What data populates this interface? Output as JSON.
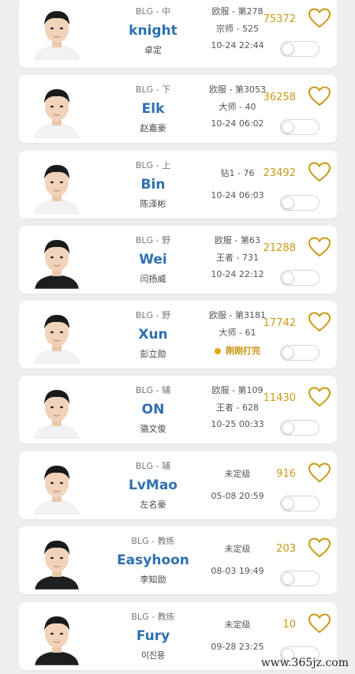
{
  "players": [
    {
      "team_pos": "BLG - 中",
      "name": "knight",
      "real": "卓定",
      "server": "欧服 - 第278",
      "tier": "宗师 - 525",
      "time": "10-24 22:44",
      "status": "",
      "likes": "75372",
      "icon": "heart-outline-icon",
      "shirt": "#f2f2f2"
    },
    {
      "team_pos": "BLG - 下",
      "name": "Elk",
      "real": "赵嘉豪",
      "server": "欧服 - 第3053",
      "tier": "大师 - 40",
      "time": "10-24 06:02",
      "status": "",
      "likes": "36258",
      "icon": "heart-outline-icon",
      "shirt": "#f2f2f2"
    },
    {
      "team_pos": "BLG - 上",
      "name": "Bin",
      "real": "陈泽彬",
      "server": "",
      "tier": "钻1 - 76",
      "time": "10-24 06:03",
      "status": "",
      "likes": "23492",
      "icon": "heart-outline-icon",
      "shirt": "#f2f2f2"
    },
    {
      "team_pos": "BLG - 野",
      "name": "Wei",
      "real": "闫扬威",
      "server": "欧服 - 第63",
      "tier": "王者 - 731",
      "time": "10-24 22:12",
      "status": "",
      "likes": "21288",
      "icon": "heart-outline-icon",
      "shirt": "#1e1e1e"
    },
    {
      "team_pos": "BLG - 野",
      "name": "Xun",
      "real": "彭立勋",
      "server": "欧服 - 第3181",
      "tier": "大师 - 61",
      "time": "",
      "status": "刚刚打完",
      "likes": "17742",
      "icon": "heart-outline-icon",
      "shirt": "#f2f2f2"
    },
    {
      "team_pos": "BLG - 辅",
      "name": "ON",
      "real": "骆文俊",
      "server": "欧服 - 第109",
      "tier": "王者 - 628",
      "time": "10-25 00:33",
      "status": "",
      "likes": "11430",
      "icon": "heart-outline-icon",
      "shirt": "#f2f2f2"
    },
    {
      "team_pos": "BLG - 辅",
      "name": "LvMao",
      "real": "左名豪",
      "server": "",
      "tier": "未定级",
      "time": "05-08 20:59",
      "status": "",
      "likes": "916",
      "icon": "heart-outline-icon",
      "shirt": "#f2f2f2"
    },
    {
      "team_pos": "BLG - 教练",
      "name": "Easyhoon",
      "real": "李知勋",
      "server": "",
      "tier": "未定级",
      "time": "08-03 19:49",
      "status": "",
      "likes": "203",
      "icon": "heart-outline-icon",
      "shirt": "#1e1e1e"
    },
    {
      "team_pos": "BLG - 教练",
      "name": "Fury",
      "real": "이진용",
      "server": "",
      "tier": "未定级",
      "time": "09-28 23:25",
      "status": "",
      "likes": "10",
      "icon": "heart-outline-icon",
      "shirt": "#1e1e1e"
    }
  ],
  "watermark": "www.365jz.com",
  "colors": {
    "name": "#2f6fb0",
    "likes": "#c99a16",
    "status": "#c7940e"
  }
}
